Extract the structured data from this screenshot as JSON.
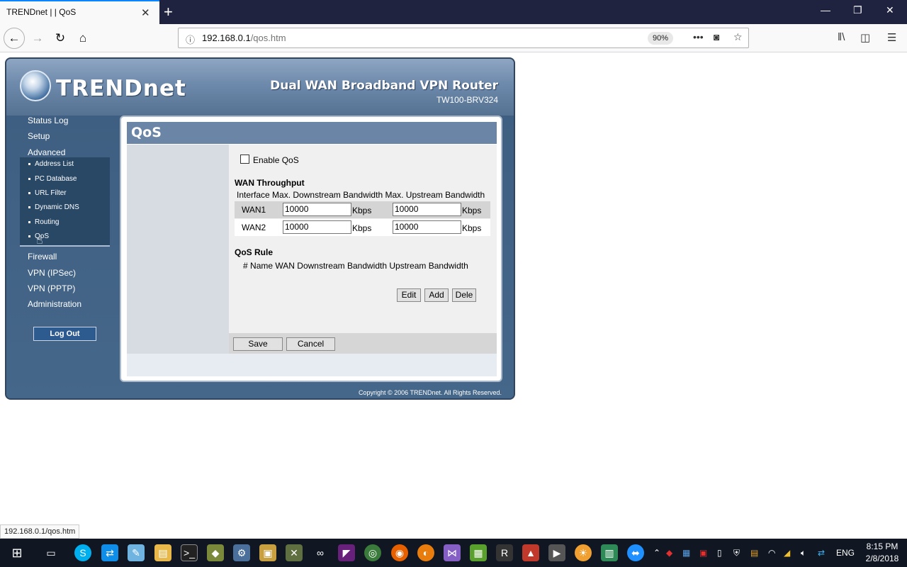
{
  "browser": {
    "tab_title": "TRENDnet | | QoS",
    "url_host": "192.168.0.1",
    "url_path": "/qos.htm",
    "zoom": "90%",
    "status_url": "192.168.0.1/qos.htm"
  },
  "router": {
    "brand": "TRENDnet",
    "product": "Dual WAN Broadband VPN Router",
    "model": "TW100-BRV324",
    "menu": {
      "status_log": "Status Log",
      "setup": "Setup",
      "advanced": "Advanced",
      "submenu": [
        "Address List",
        "PC Database",
        "URL Filter",
        "Dynamic DNS",
        "Routing",
        "QoS"
      ],
      "firewall": "Firewall",
      "vpn_ipsec": "VPN (IPSec)",
      "vpn_pptp": "VPN (PPTP)",
      "administration": "Administration",
      "logout": "Log Out"
    },
    "page_title": "QoS",
    "enable_qos_label": "Enable QoS",
    "enable_qos_checked": false,
    "wan_throughput": {
      "heading": "WAN Throughput",
      "columns": [
        "Interface",
        "Max. Downstream Bandwidth",
        "Max. Upstream Bandwidth"
      ],
      "rows": [
        {
          "iface": "WAN1",
          "down": "10000",
          "down_unit": "Kbps",
          "up": "10000",
          "up_unit": "Kbps"
        },
        {
          "iface": "WAN2",
          "down": "10000",
          "down_unit": "Kbps",
          "up": "10000",
          "up_unit": "Kbps"
        }
      ]
    },
    "qos_rule": {
      "heading": "QoS Rule",
      "columns": [
        "#",
        "Name",
        "WAN",
        "Downstream Bandwidth",
        "Upstream Bandwidth"
      ],
      "buttons": {
        "edit": "Edit",
        "add": "Add",
        "delete": "Dele"
      }
    },
    "save": "Save",
    "cancel": "Cancel",
    "copyright": "Copyright © 2006 TRENDnet. All Rights Reserved."
  },
  "taskbar": {
    "language": "ENG",
    "time": "8:15 PM",
    "date": "2/8/2018"
  }
}
